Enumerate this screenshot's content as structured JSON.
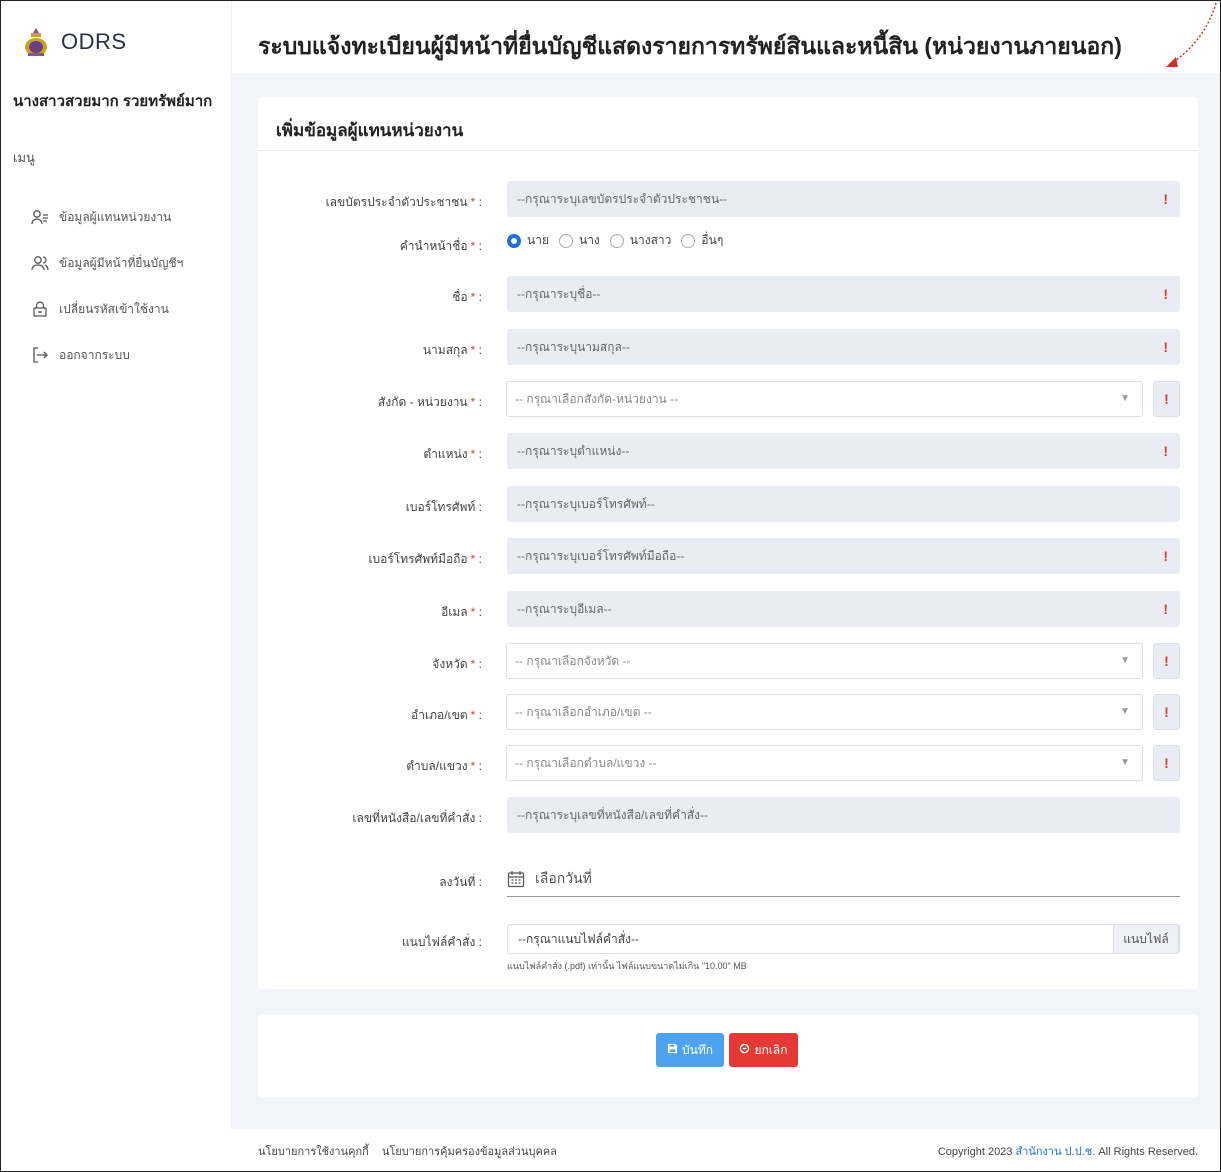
{
  "sidebar": {
    "brand": "ODRS",
    "user_name": "นางสาวสวยมาก รวยทรัพย์มาก",
    "menu_title": "เมนู",
    "items": [
      {
        "label": "ข้อมูลผู้แทนหน่วยงาน",
        "icon": "user-list-icon"
      },
      {
        "label": "ข้อมูลผู้มีหน้าที่ยื่นบัญชีฯ",
        "icon": "users-icon"
      },
      {
        "label": "เปลี่ยนรหัสเข้าใช้งาน",
        "icon": "lock-icon"
      },
      {
        "label": "ออกจากระบบ",
        "icon": "logout-icon"
      }
    ]
  },
  "header": {
    "title": "ระบบแจ้งทะเบียนผู้มีหน้าที่ยื่นบัญชีแสดงรายการทรัพย์สินและหนี้สิน (หน่วยงานภายนอก)"
  },
  "form": {
    "title": "เพิ่มข้อมูลผู้แทนหน่วยงาน",
    "id_card": {
      "label": "เลขบัตรประจำตัวประชาชน",
      "placeholder": "--กรุณาระบุเลขบัตรประจำตัวประชาชน--"
    },
    "prefix": {
      "label": "คำนำหน้าชื่อ",
      "options": [
        "นาย",
        "นาง",
        "นางสาว",
        "อื่นๆ"
      ],
      "selected": "นาย"
    },
    "first_name": {
      "label": "ชื่อ",
      "placeholder": "--กรุณาระบุชื่อ--"
    },
    "last_name": {
      "label": "นามสกุล",
      "placeholder": "--กรุณาระบุนามสกุล--"
    },
    "agency": {
      "label": "สังกัด - หน่วยงาน",
      "placeholder": "-- กรุณาเลือกสังกัด-หน่วยงาน --"
    },
    "position": {
      "label": "ตำแหน่ง",
      "placeholder": "--กรุณาระบุตำแหน่ง--"
    },
    "phone": {
      "label": "เบอร์โทรศัพท์ :",
      "placeholder": "--กรุณาระบุเบอร์โทรศัพท์--"
    },
    "mobile": {
      "label": "เบอร์โทรศัพท์มือถือ",
      "placeholder": "--กรุณาระบุเบอร์โทรศัพท์มือถือ--"
    },
    "email": {
      "label": "อีเมล",
      "placeholder": "--กรุณาระบุอีเมล--"
    },
    "province": {
      "label": "จังหวัด",
      "placeholder": "-- กรุณาเลือกจังหวัด --"
    },
    "district": {
      "label": "อำเภอ/เขต",
      "placeholder": "-- กรุณาเลือกอำเภอ/เขต --"
    },
    "subdistrict": {
      "label": "ตำบล/แขวง",
      "placeholder": "-- กรุณาเลือกตำบล/แขวง --"
    },
    "doc_no": {
      "label": "เลขที่หนังสือ/เลขที่คำสั่ง :",
      "placeholder": "--กรุณาระบุเลขที่หนังสือ/เลขที่คำสั่ง--"
    },
    "date": {
      "label": "ลงวันที่ :",
      "placeholder": "เลือกวันที่"
    },
    "file": {
      "label": "แนบไฟล์คำสั่ง :",
      "placeholder": "--กรุณาแนบไฟล์คำสั่ง--",
      "button": "แนบไฟล์",
      "note": "แนบไฟล์คำสั่ง (.pdf) เท่านั้น ไฟล์แนบขนาดไม่เกิน \"10.00\" MB"
    },
    "required_mark": "*",
    "colon": ":",
    "warn_mark": "!"
  },
  "actions": {
    "save": "บันทึก",
    "cancel": "ยกเลิก"
  },
  "footer": {
    "cookie_policy": "นโยบายการใช้งานคุกกี้",
    "privacy_policy": "นโยบายการคุ้มครองข้อมูลส่วนบุคคล",
    "copyright_prefix": "Copyright 2023",
    "org": "สำนักงาน ป.ป.ช.",
    "copyright_suffix": "All Rights Reserved."
  },
  "colors": {
    "primary": "#1e6fd9",
    "danger": "#e53935",
    "save": "#4da3f0"
  }
}
